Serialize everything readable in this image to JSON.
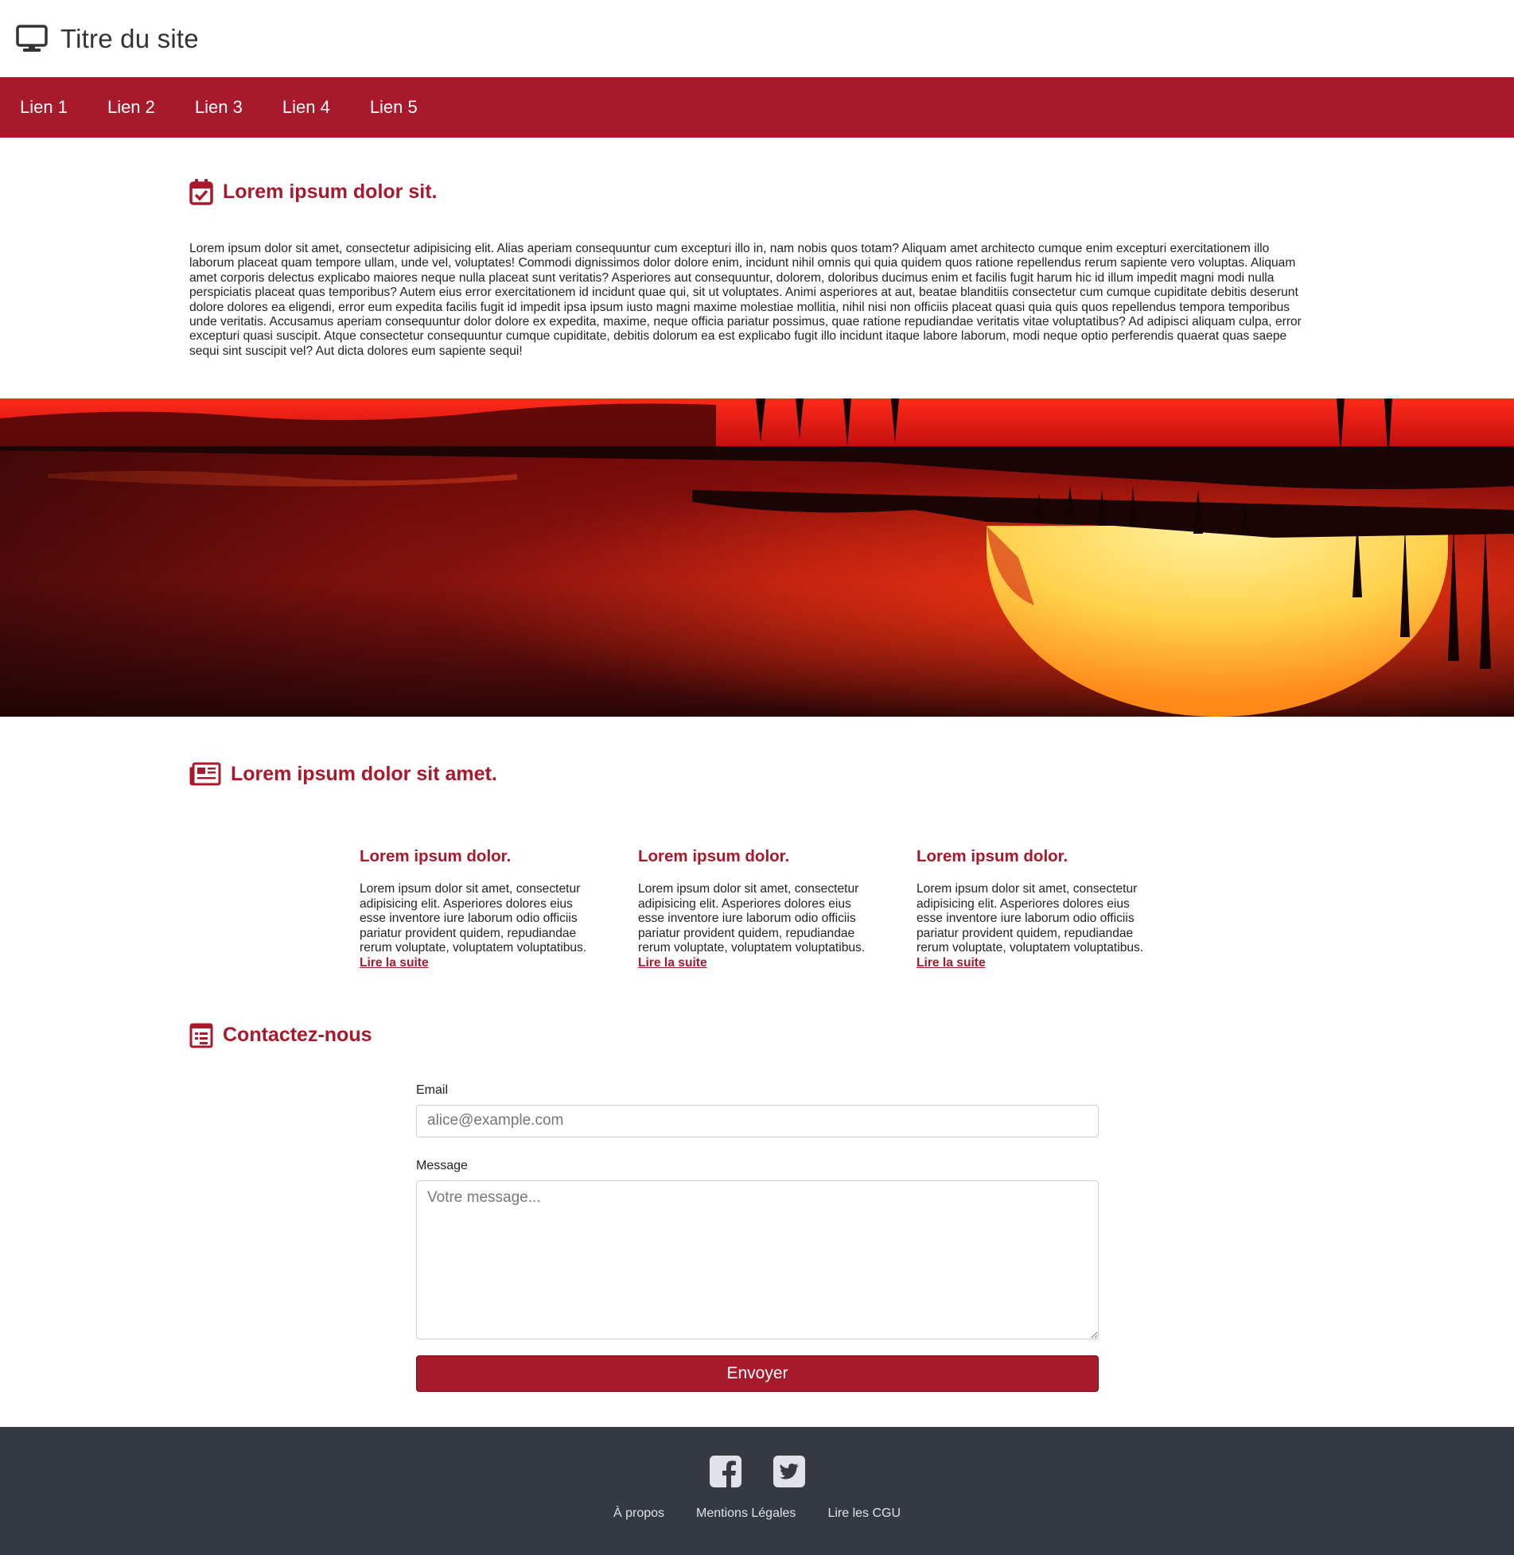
{
  "header": {
    "title": "Titre du site",
    "logo_icon": "desktop-monitor-icon"
  },
  "nav": {
    "links": [
      "Lien 1",
      "Lien 2",
      "Lien 3",
      "Lien 4",
      "Lien 5"
    ]
  },
  "colors": {
    "accent": "#a8192b",
    "footer": "#353a42"
  },
  "intro": {
    "icon": "calendar-check-icon",
    "title": "Lorem ipsum dolor sit.",
    "text": "Lorem ipsum dolor sit amet, consectetur adipisicing elit. Alias aperiam consequuntur cum excepturi illo in, nam nobis quos totam? Aliquam amet architecto cumque enim excepturi exercitationem illo laborum placeat quam tempore ullam, unde vel, voluptates! Commodi dignissimos dolor dolore enim, incidunt nihil omnis qui quia quidem quos ratione repellendus rerum sapiente vero voluptas. Aliquam amet corporis delectus explicabo maiores neque nulla placeat sunt veritatis? Asperiores aut consequuntur, dolorem, doloribus ducimus enim et facilis fugit harum hic id illum impedit magni modi nulla perspiciatis placeat quas temporibus? Autem eius error exercitationem id incidunt quae qui, sit ut voluptates. Animi asperiores at aut, beatae blanditiis consectetur cum cumque cupiditate debitis deserunt dolore dolores ea eligendi, error eum expedita facilis fugit id impedit ipsa ipsum iusto magni maxime molestiae mollitia, nihil nisi non officiis placeat quasi quia quis quos repellendus tempora temporibus unde veritatis. Accusamus aperiam consequuntur dolor dolore ex expedita, maxime, neque officia pariatur possimus, quae ratione repudiandae veritatis vitae voluptatibus? Ad adipisci aliquam culpa, error excepturi quasi suscipit. Atque consectetur consequuntur cumque cupiditate, debitis dolorum ea est explicabo fugit illo incidunt itaque labore laborum, modi neque optio perferendis quaerat quas saepe sequi sint suscipit vel? Aut dicta dolores eum sapiente sequi!"
  },
  "banner": {
    "scene": "sunset over lake with palm trees"
  },
  "news": {
    "icon": "newspaper-icon",
    "title": "Lorem ipsum dolor sit amet.",
    "articles": [
      {
        "title": "Lorem ipsum dolor.",
        "text": "Lorem ipsum dolor sit amet, consectetur adipisicing elit. Asperiores dolores eius esse inventore iure laborum odio officiis pariatur provident quidem, repudiandae rerum voluptate, voluptatem voluptatibus.",
        "link": "Lire la suite"
      },
      {
        "title": "Lorem ipsum dolor.",
        "text": "Lorem ipsum dolor sit amet, consectetur adipisicing elit. Asperiores dolores eius esse inventore iure laborum odio officiis pariatur provident quidem, repudiandae rerum voluptate, voluptatem voluptatibus.",
        "link": "Lire la suite"
      },
      {
        "title": "Lorem ipsum dolor.",
        "text": "Lorem ipsum dolor sit amet, consectetur adipisicing elit. Asperiores dolores eius esse inventore iure laborum odio officiis pariatur provident quidem, repudiandae rerum voluptate, voluptatem voluptatibus.",
        "link": "Lire la suite"
      }
    ]
  },
  "contact": {
    "icon": "contact-form-icon",
    "title": "Contactez-nous",
    "email_label": "Email",
    "email_placeholder": "alice@example.com",
    "email_value": "",
    "message_label": "Message",
    "message_placeholder": "Votre message...",
    "message_value": "",
    "submit_label": "Envoyer"
  },
  "footer": {
    "social": [
      "facebook-icon",
      "twitter-icon"
    ],
    "links": [
      "À propos",
      "Mentions Légales",
      "Lire les CGU"
    ]
  }
}
